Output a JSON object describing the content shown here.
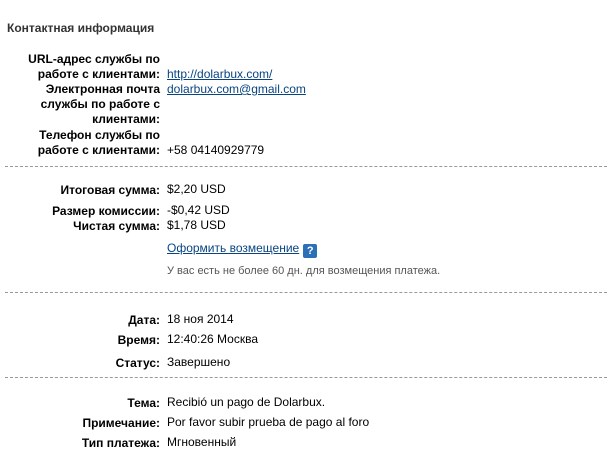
{
  "contact": {
    "title": "Контактная информация",
    "url_label_1": "URL-адрес службы по",
    "url_label_2": "работе с клиентами:",
    "url_value": "http://dolarbux.com/",
    "email_label_1": "Электронная почта",
    "email_label_2": "службы по работе с",
    "email_label_3": "клиентами:",
    "email_value": "dolarbux.com@gmail.com",
    "phone_label_1": "Телефон службы по",
    "phone_label_2": "работе с клиентами:",
    "phone_value": "+58 04140929779"
  },
  "amounts": {
    "total_label": "Итоговая сумма:",
    "total_value": "$2,20 USD",
    "fee_label": "Размер комиссии:",
    "fee_value": "-$0,42 USD",
    "net_label": "Чистая сумма:",
    "net_value": "$1,78 USD",
    "refund_link": "Оформить возмещение",
    "help_icon": "?",
    "refund_note": "У вас есть не более 60 дн. для возмещения платежа."
  },
  "details": {
    "date_label": "Дата:",
    "date_value": "18 ноя 2014",
    "time_label": "Время:",
    "time_value": "12:40:26 Москва",
    "status_label": "Статус:",
    "status_value": "Завершено"
  },
  "message": {
    "subject_label": "Тема:",
    "subject_value": "Recibió un pago de Dolarbux.",
    "note_label": "Примечание:",
    "note_value": "Por favor subir prueba de pago al foro",
    "type_label": "Тип платежа:",
    "type_value": "Мгновенный"
  },
  "colors": {
    "link": "#084482",
    "help_icon_bg": "#2b6fb6",
    "separator": "#999999"
  },
  "icons": {
    "help": "question-mark-icon"
  }
}
